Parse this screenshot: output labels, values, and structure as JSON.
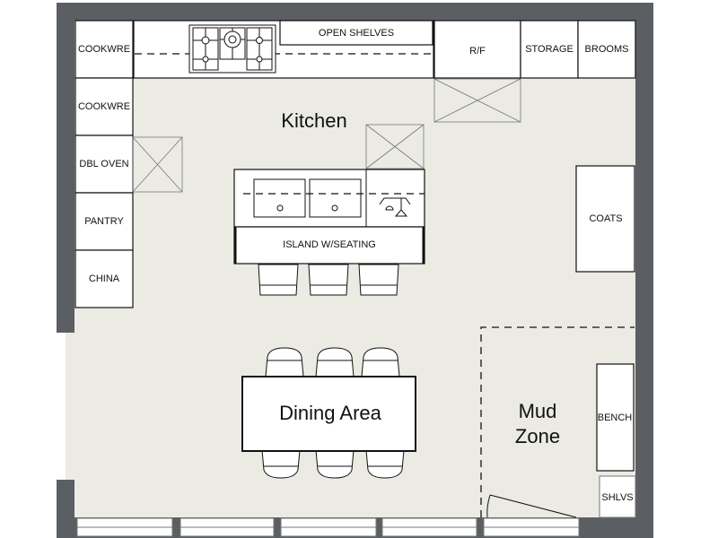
{
  "rooms": {
    "kitchen": "Kitchen",
    "dining": "Dining Area",
    "mud_line1": "Mud",
    "mud_line2": "Zone"
  },
  "fixtures": {
    "cookware1": "COOKWRE",
    "cookware2": "COOKWRE",
    "dbl_oven": "DBL OVEN",
    "pantry": "PANTRY",
    "china": "CHINA",
    "open_shelves": "OPEN SHELVES",
    "fridge": "R/F",
    "storage": "STORAGE",
    "brooms": "BROOMS",
    "island": "ISLAND W/SEATING",
    "coats": "COATS",
    "bench": "BENCH",
    "shelves": "SHLVS"
  },
  "colors": {
    "wall": "#5b5f63",
    "floor": "#ebebe4"
  }
}
